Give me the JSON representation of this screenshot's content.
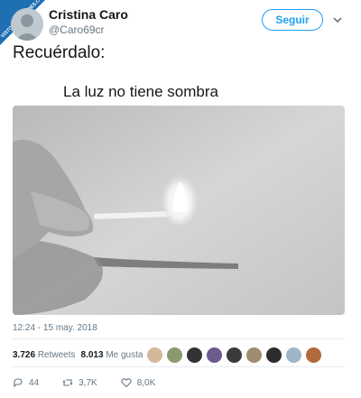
{
  "watermark": {
    "text": "VISTOENLASREDES.COM"
  },
  "user": {
    "name": "Cristina Caro",
    "handle": "@Caro69cr"
  },
  "follow_label": "Seguir",
  "tweet": {
    "text": "Recuérdalo:",
    "quote": "La luz no tiene sombra",
    "timestamp": "12:24 - 15 may. 2018"
  },
  "stats": {
    "retweets_count": "3.726",
    "retweets_label": "Retweets",
    "likes_count": "8.013",
    "likes_label": "Me gusta"
  },
  "actions": {
    "replies": "44",
    "retweets": "3,7K",
    "likes": "8,0K"
  },
  "colors": {
    "accent": "#1da1f2",
    "secondary_text": "#657786",
    "border": "#e6ecf0"
  },
  "icons": [
    "chevron-down-icon",
    "reply-icon",
    "retweet-icon",
    "heart-icon"
  ]
}
